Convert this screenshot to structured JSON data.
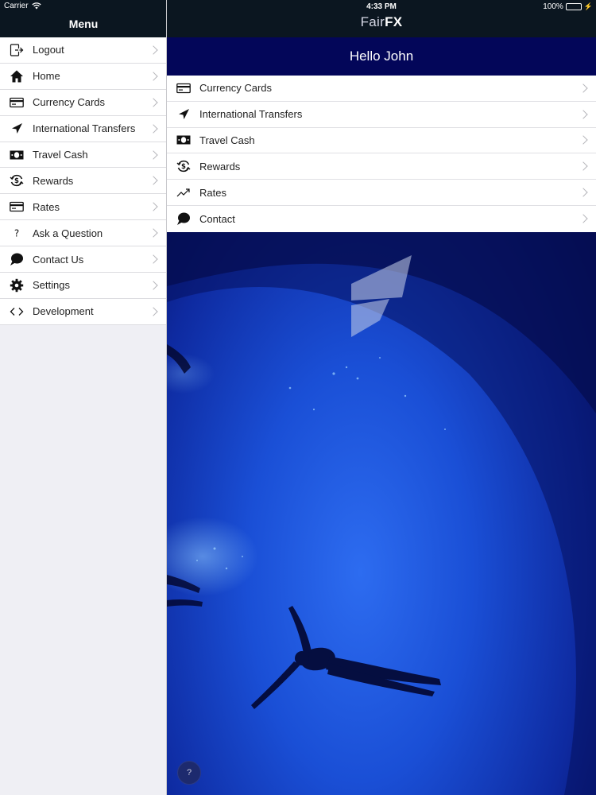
{
  "status_bar": {
    "carrier": "Carrier",
    "time": "4:33 PM",
    "battery": "100%"
  },
  "sidebar": {
    "title": "Menu",
    "items": [
      {
        "label": "Logout",
        "icon": "logout-icon"
      },
      {
        "label": "Home",
        "icon": "home-icon"
      },
      {
        "label": "Currency Cards",
        "icon": "card-icon"
      },
      {
        "label": "International Transfers",
        "icon": "send-icon"
      },
      {
        "label": "Travel Cash",
        "icon": "cash-icon"
      },
      {
        "label": "Rewards",
        "icon": "rewards-icon"
      },
      {
        "label": "Rates",
        "icon": "rates-card-icon"
      },
      {
        "label": "Ask a Question",
        "icon": "question-icon"
      },
      {
        "label": "Contact Us",
        "icon": "chat-icon"
      },
      {
        "label": "Settings",
        "icon": "gear-icon"
      },
      {
        "label": "Development",
        "icon": "code-icon"
      }
    ]
  },
  "header": {
    "brand_light": "Fair",
    "brand_bold": "FX",
    "greeting": "Hello John"
  },
  "main": {
    "items": [
      {
        "label": "Currency Cards",
        "icon": "card-icon"
      },
      {
        "label": "International Transfers",
        "icon": "send-icon"
      },
      {
        "label": "Travel Cash",
        "icon": "cash-icon"
      },
      {
        "label": "Rewards",
        "icon": "rewards-icon"
      },
      {
        "label": "Rates",
        "icon": "trend-icon"
      },
      {
        "label": "Contact",
        "icon": "chat-icon"
      }
    ],
    "help_label": "?"
  },
  "colors": {
    "nav_bar": "#0b1620",
    "greeting_bar": "#030659",
    "ocean": "#0a1b7a",
    "battery": "#4cd964"
  }
}
